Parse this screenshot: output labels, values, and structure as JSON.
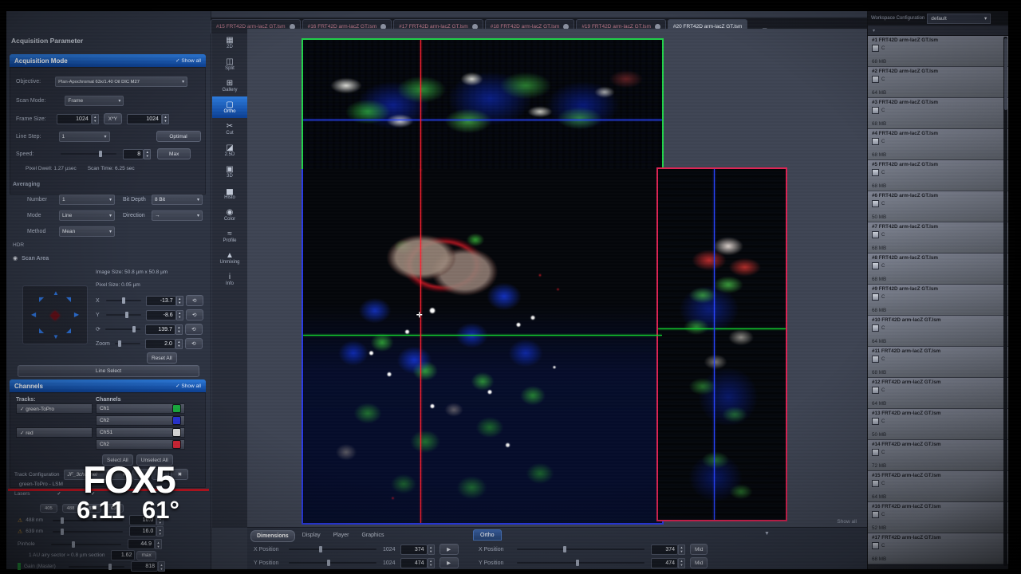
{
  "overlay": {
    "station": "FOX5",
    "time": "6:11",
    "temp": "61°"
  },
  "workspace": {
    "label": "Workspace Configuration",
    "preset": "default"
  },
  "tabs": {
    "items": [
      {
        "label": "#15 FRT42D arm-lacZ GT.lsm"
      },
      {
        "label": "#16 FRT42D arm-lacZ GT.lsm"
      },
      {
        "label": "#17 FRT42D arm-lacZ GT.lsm"
      },
      {
        "label": "#18 FRT42D arm-lacZ GT.lsm"
      },
      {
        "label": "#19 FRT42D arm-lacZ GT.lsm"
      },
      {
        "label": "#20 FRT42D arm-lacZ GT.lsm"
      }
    ],
    "prev": "◄",
    "next": "►",
    "grid": "▦"
  },
  "toolbar": {
    "items": [
      {
        "label": "2D",
        "glyph": "▦"
      },
      {
        "label": "Split",
        "glyph": "◫"
      },
      {
        "label": "Gallery",
        "glyph": "⊞"
      },
      {
        "label": "Ortho",
        "glyph": "▢"
      },
      {
        "label": "Cut",
        "glyph": "✂"
      },
      {
        "label": "2.5D",
        "glyph": "◪"
      },
      {
        "label": "3D",
        "glyph": "▣"
      },
      {
        "label": "Histo",
        "glyph": "▅"
      },
      {
        "label": "Color",
        "glyph": "◉"
      },
      {
        "label": "Profile",
        "glyph": "≈"
      },
      {
        "label": "Unmixing",
        "glyph": "▲"
      },
      {
        "label": "Info",
        "glyph": "i"
      }
    ]
  },
  "left_panel": {
    "title": "Acquisition Parameter",
    "mode": {
      "title": "Acquisition Mode",
      "show_all": "✓ Show all",
      "pin": "◥",
      "objective_label": "Objective:",
      "objective": "Plan-Apochromat 63x/1.40 Oil DIC M27",
      "scan_mode_label": "Scan Mode:",
      "scan_mode": "Frame",
      "frame_size_label": "Frame Size:",
      "frame_x": "1024",
      "xy_button": "X*Y",
      "frame_y": "1024",
      "line_step_label": "Line Step:",
      "line_step": "1",
      "optimal": "Optimal",
      "speed_label": "Speed:",
      "speed": "8",
      "max": "Max",
      "pixel_dwell": "Pixel Dwell:   1.27 µsec",
      "scan_time": "Scan Time:   6.25 sec"
    },
    "averaging": {
      "title": "Averaging",
      "number_label": "Number",
      "number": "1",
      "bit_depth_label": "Bit Depth",
      "bit_depth": "8 Bit",
      "mode_label": "Mode",
      "mode": "Line",
      "direction_label": "Direction",
      "direction": "→",
      "method_label": "Method",
      "method": "Mean",
      "hdr_label": "HDR"
    },
    "scan_area": {
      "title": "Scan Area",
      "image_size": "Image Size:   50.8 µm x 50.8 µm",
      "pixel_size": "Pixel Size:   0.05 µm",
      "x_label": "X",
      "x": "-13.7",
      "y_label": "Y",
      "y": "-8.6",
      "rot_label": "⟳",
      "rot": "139.7",
      "zoom_label": "Zoom",
      "zoom": "2.0",
      "reset_all": "Reset All",
      "line_select": "Line Select"
    },
    "channels": {
      "title": "Channels",
      "show_all": "✓ Show all",
      "pin": "◥",
      "tracks_header": "Tracks:",
      "channels_header": "Channels",
      "rows": [
        {
          "track": "✓  green-ToPro",
          "channel": "Ch1",
          "color": "#1fae43"
        },
        {
          "track": "",
          "channel": "Ch2",
          "color": "#2a35d4"
        },
        {
          "track": "✓  red",
          "channel": "ChS1",
          "color": "#e8e8e8"
        },
        {
          "track": "",
          "channel": "Ch2",
          "color": "#d42a3a"
        }
      ],
      "select_all": "Select All",
      "unselect_all": "Unselect All",
      "track_config_label": "Track Configuration",
      "track_config": "JF_3channel",
      "lsm_label": "green-ToPro - LSM",
      "lasers_label": "Lasers",
      "checks": "✓        ✓",
      "wavelengths": [
        "405",
        "488",
        "555",
        "639"
      ],
      "laser_rows": [
        {
          "name": "488 nm",
          "value": "16.0"
        },
        {
          "name": "639 nm",
          "value": "16.0"
        }
      ],
      "pinhole_label": "Pinhole",
      "pinhole": "44.9",
      "airy_note": "1 AU airy sector   ≈   0.8 µm section",
      "airy_max": "1.62",
      "airy_max_btn": "max",
      "gain_label": "Gain (Master)",
      "gain": "818"
    }
  },
  "canvas": {
    "ortho_tab": "Ortho",
    "show_all": "Show all"
  },
  "bottom": {
    "tabs": [
      {
        "label": "Dimensions"
      },
      {
        "label": "Display"
      },
      {
        "label": "Player"
      },
      {
        "label": "Graphics"
      }
    ],
    "rows": [
      {
        "label": "X Position",
        "max": "1024",
        "value": "374"
      },
      {
        "label": "Y Position",
        "max": "1024",
        "value": "474"
      }
    ],
    "ortho": {
      "x_label": "X Position",
      "x": "374",
      "y_label": "Y Position",
      "y": "474",
      "mid": "Mid"
    },
    "collapse": "▼"
  },
  "files": {
    "items": [
      {
        "name": "#1 FRT42D arm-lacZ GT.lsm",
        "badge": "C",
        "size": "68 MB"
      },
      {
        "name": "#2 FRT42D arm-lacZ GT.lsm",
        "badge": "C",
        "size": "64 MB"
      },
      {
        "name": "#3 FRT42D arm-lacZ GT.lsm",
        "badge": "C",
        "size": "68 MB"
      },
      {
        "name": "#4 FRT42D arm-lacZ GT.lsm",
        "badge": "C",
        "size": "68 MB"
      },
      {
        "name": "#5 FRT42D arm-lacZ GT.lsm",
        "badge": "C",
        "size": "68 MB"
      },
      {
        "name": "#6 FRT42D arm-lacZ GT.lsm",
        "badge": "C",
        "size": "50 MB"
      },
      {
        "name": "#7 FRT42D arm-lacZ GT.lsm",
        "badge": "C",
        "size": "68 MB"
      },
      {
        "name": "#8 FRT42D arm-lacZ GT.lsm",
        "badge": "C",
        "size": "68 MB"
      },
      {
        "name": "#9 FRT42D arm-lacZ GT.lsm",
        "badge": "C",
        "size": "68 MB"
      },
      {
        "name": "#10 FRT42D arm-lacZ GT.lsm",
        "badge": "C",
        "size": "64 MB"
      },
      {
        "name": "#11 FRT42D arm-lacZ GT.lsm",
        "badge": "C",
        "size": "68 MB"
      },
      {
        "name": "#12 FRT42D arm-lacZ GT.lsm",
        "badge": "C",
        "size": "64 MB"
      },
      {
        "name": "#13 FRT42D arm-lacZ GT.lsm",
        "badge": "C",
        "size": "50 MB"
      },
      {
        "name": "#14 FRT42D arm-lacZ GT.lsm",
        "badge": "C",
        "size": "72 MB"
      },
      {
        "name": "#15 FRT42D arm-lacZ GT.lsm",
        "badge": "C",
        "size": "64 MB"
      },
      {
        "name": "#16 FRT42D arm-lacZ GT.lsm",
        "badge": "C",
        "size": "52 MB"
      },
      {
        "name": "#17 FRT42D arm-lacZ GT.lsm",
        "badge": "C",
        "size": "68 MB"
      }
    ]
  }
}
